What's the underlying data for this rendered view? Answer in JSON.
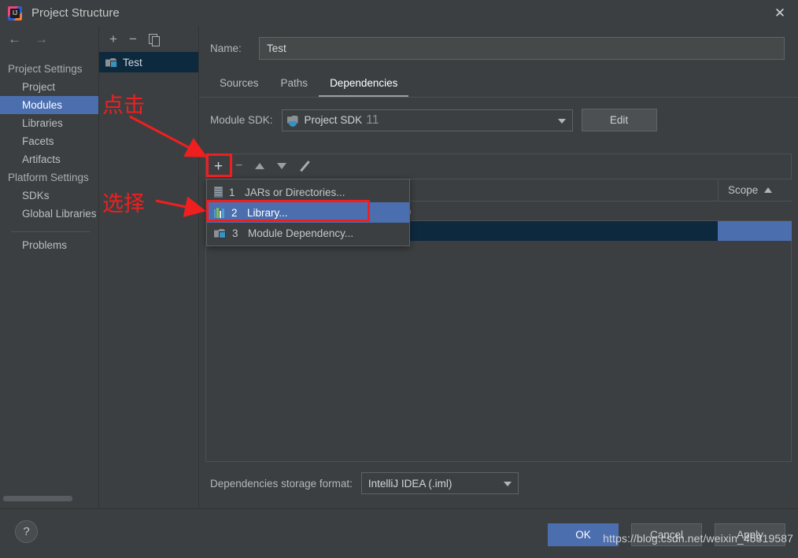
{
  "window": {
    "title": "Project Structure",
    "app_icon": "intellij-idea-icon",
    "close_icon": "close-icon"
  },
  "left_nav": {
    "back_icon": "back-arrow-icon",
    "forward_icon": "forward-arrow-icon",
    "groups": [
      {
        "label": "Project Settings",
        "items": [
          "Project",
          "Modules",
          "Libraries",
          "Facets",
          "Artifacts"
        ]
      },
      {
        "label": "Platform Settings",
        "items": [
          "SDKs",
          "Global Libraries"
        ]
      }
    ],
    "selected": "Modules",
    "extra_items": [
      "Problems"
    ]
  },
  "modules_panel": {
    "toolbar": {
      "add": "+",
      "remove": "−",
      "copy_icon": "copy-icon"
    },
    "items": [
      {
        "label": "Test",
        "icon": "module-icon",
        "selected": true
      }
    ]
  },
  "content": {
    "name_label": "Name:",
    "name_value": "Test",
    "tabs": [
      {
        "label": "Sources",
        "active": false
      },
      {
        "label": "Paths",
        "active": false
      },
      {
        "label": "Dependencies",
        "active": true
      }
    ],
    "module_sdk_label": "Module SDK:",
    "module_sdk_value": "Project SDK",
    "module_sdk_version": "11",
    "edit_button": "Edit",
    "deps_toolbar": {
      "add": "+",
      "remove": "−",
      "move_up_icon": "arrow-up-icon",
      "move_down_icon": "arrow-down-icon",
      "edit_icon": "pencil-icon"
    },
    "table": {
      "columns": [
        "",
        "Scope"
      ],
      "sort_indicator": "ascending",
      "rows": [
        {
          "name": ")",
          "scope": ""
        },
        {
          "name": "",
          "scope": "",
          "highlighted": true
        }
      ]
    },
    "storage_format_label": "Dependencies storage format:",
    "storage_format_value": "IntelliJ IDEA (.iml)"
  },
  "popup_menu": {
    "items": [
      {
        "num": "1",
        "label": "JARs or Directories...",
        "icon": "jar-icon",
        "selected": false
      },
      {
        "num": "2",
        "label": "Library...",
        "icon": "library-icon",
        "selected": true
      },
      {
        "num": "3",
        "label": "Module Dependency...",
        "icon": "module-dependency-icon",
        "selected": false
      }
    ]
  },
  "footer": {
    "help_label": "?",
    "ok": "OK",
    "cancel": "Cancel",
    "apply": "Apply"
  },
  "annotations": {
    "click_label": "点击",
    "select_label": "选择",
    "color": "#f01f1f"
  },
  "watermark": "https://blog.csdn.net/weixin_45819587"
}
